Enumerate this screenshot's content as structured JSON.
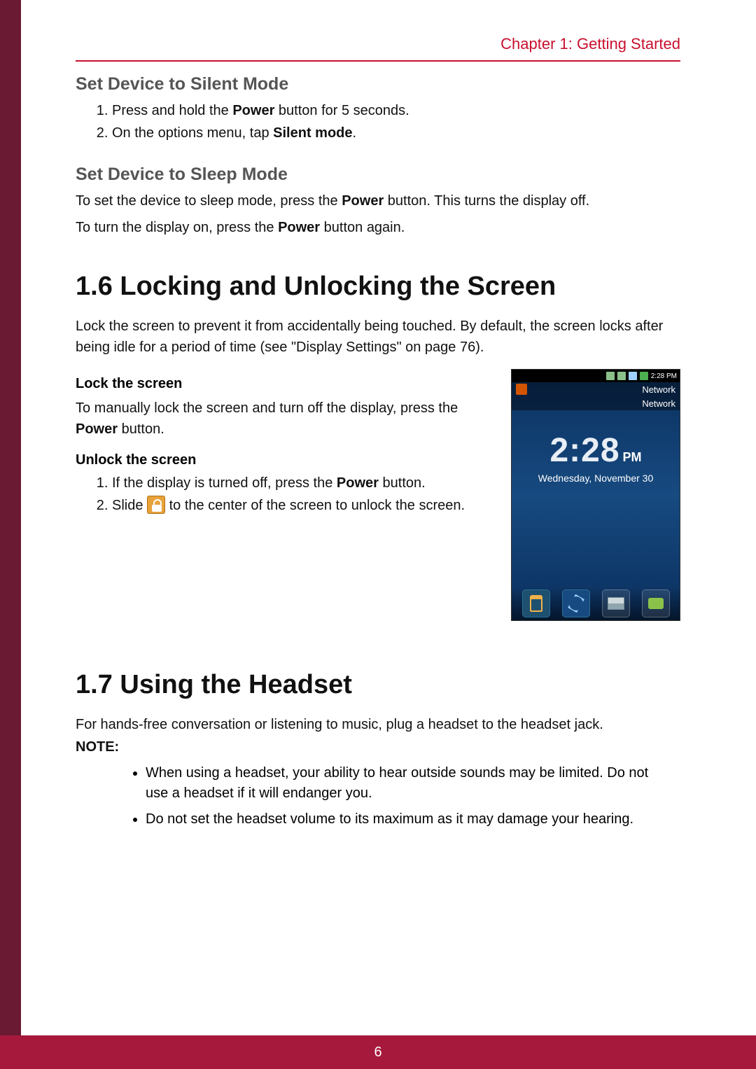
{
  "header": {
    "chapter": "Chapter 1: Getting Started"
  },
  "silent": {
    "heading": "Set Device to Silent Mode",
    "step1_pre": "Press and hold the ",
    "step1_bold": "Power",
    "step1_post": " button for 5 seconds.",
    "step2_pre": "On the options menu, tap ",
    "step2_bold": "Silent mode",
    "step2_post": "."
  },
  "sleep": {
    "heading": "Set Device to Sleep Mode",
    "p1_pre": "To set the device to sleep mode, press the ",
    "p1_bold": "Power",
    "p1_post": " button. This turns the display off.",
    "p2_pre": "To turn the display on, press the ",
    "p2_bold": "Power",
    "p2_post": " button again."
  },
  "sec16": {
    "title": "1.6 Locking and Unlocking the Screen",
    "intro": "Lock the screen to prevent it from accidentally being touched. By default, the screen locks after being idle for a period of time (see \"Display Settings\" on page 76).",
    "lock_head": "Lock the screen",
    "lock_text_pre": "To manually lock the screen and turn off the display, press the ",
    "lock_text_bold": "Power",
    "lock_text_post": " button.",
    "unlock_head": "Unlock the screen",
    "unlock_step1_pre": "If the display is turned off, press the ",
    "unlock_step1_bold": "Power",
    "unlock_step1_post": " button.",
    "unlock_step2_pre": "Slide ",
    "unlock_step2_post": " to the center of the screen to unlock the screen."
  },
  "phone": {
    "status_time": "2:28 PM",
    "notif1": "Network",
    "notif2": "Network",
    "clock": "2:28",
    "ampm": "PM",
    "date": "Wednesday, November 30"
  },
  "sec17": {
    "title": "1.7 Using the Headset",
    "p1": "For hands-free conversation or listening to music, plug a headset to the headset jack.",
    "note_label": "NOTE:",
    "bullet1": "When using a headset, your ability to hear outside sounds may be limited. Do not use a headset if it will endanger you.",
    "bullet2": "Do not set the headset volume to its maximum as it may damage your hearing."
  },
  "footer": {
    "page_number": "6"
  }
}
